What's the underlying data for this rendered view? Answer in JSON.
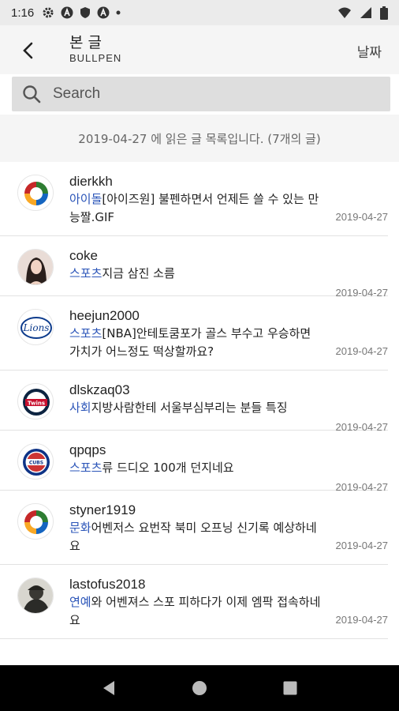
{
  "status": {
    "time": "1:16",
    "icons": [
      "gear-icon",
      "a-icon",
      "shield-icon",
      "a-icon",
      "dot-icon",
      "wifi-icon",
      "signal-icon",
      "battery-icon"
    ]
  },
  "header": {
    "title": "본 글",
    "subtitle": "BULLPEN",
    "date_button": "날짜"
  },
  "search": {
    "placeholder": "Search",
    "value": ""
  },
  "info": "2019-04-27 에 읽은 글 목록입니다. (7개의 글)",
  "items": [
    {
      "user": "dierkkh",
      "category": "아이돌",
      "text": "[아이즈원] 불펜하면서 언제든 쓸 수 있는 만능짤.GIF",
      "date": "2019-04-27",
      "avatar": "emblem"
    },
    {
      "user": "coke",
      "category": "스포츠",
      "text": "지금 삼진 소름",
      "date": "2019-04-27",
      "avatar": "photo-woman"
    },
    {
      "user": "heejun2000",
      "category": "스포츠",
      "text": "[NBA]안테토쿰포가 골스 부수고 우승하면 가치가 어느정도 떡상할까요?",
      "date": "2019-04-27",
      "avatar": "lions"
    },
    {
      "user": "dlskzaq03",
      "category": "사회",
      "text": "지방사람한테 서울부심부리는 분들 특징",
      "date": "2019-04-27",
      "avatar": "twins"
    },
    {
      "user": "qpqps",
      "category": "스포츠",
      "text": "류 드디오 100개 던지네요",
      "date": "2019-04-27",
      "avatar": "cubs"
    },
    {
      "user": "styner1919",
      "category": "문화",
      "text": "어벤저스 요번작 북미 오프닝 신기록 예상하네요",
      "date": "2019-04-27",
      "avatar": "emblem"
    },
    {
      "user": "lastofus2018",
      "category": "연예",
      "text": "와 어벤져스 스포 피하다가 이제 엠팍 접속하네요",
      "date": "2019-04-27",
      "avatar": "photo-soldier"
    }
  ]
}
